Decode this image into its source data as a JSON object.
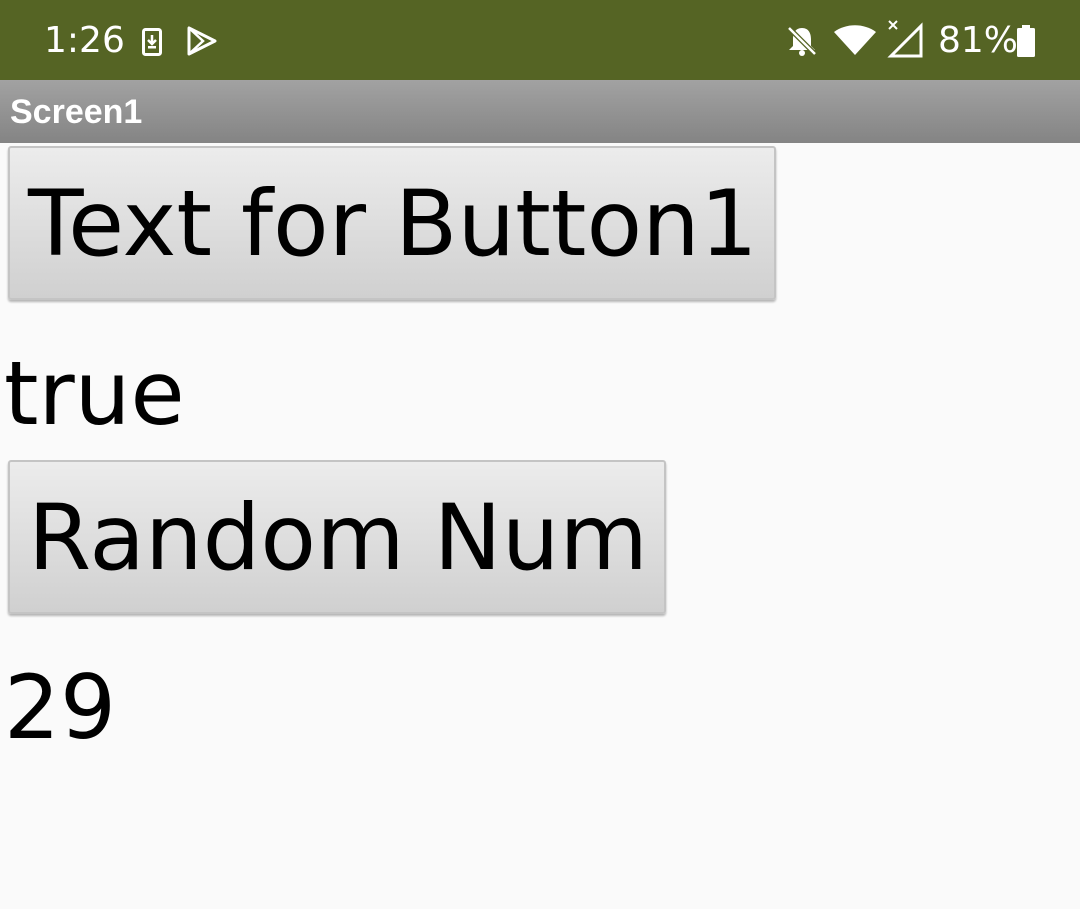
{
  "status_bar": {
    "time": "1:26",
    "battery_percent": "81%",
    "background_color": "#556424",
    "icons": [
      "download-notification-icon",
      "play-store-icon",
      "notifications-off-icon",
      "wifi-icon",
      "no-signal-icon",
      "battery-icon"
    ]
  },
  "title_bar": {
    "title": "Screen1"
  },
  "main": {
    "button1_label": "Text for Button1",
    "label1_text": "true",
    "button2_label": "Random Num",
    "label2_text": "29"
  }
}
